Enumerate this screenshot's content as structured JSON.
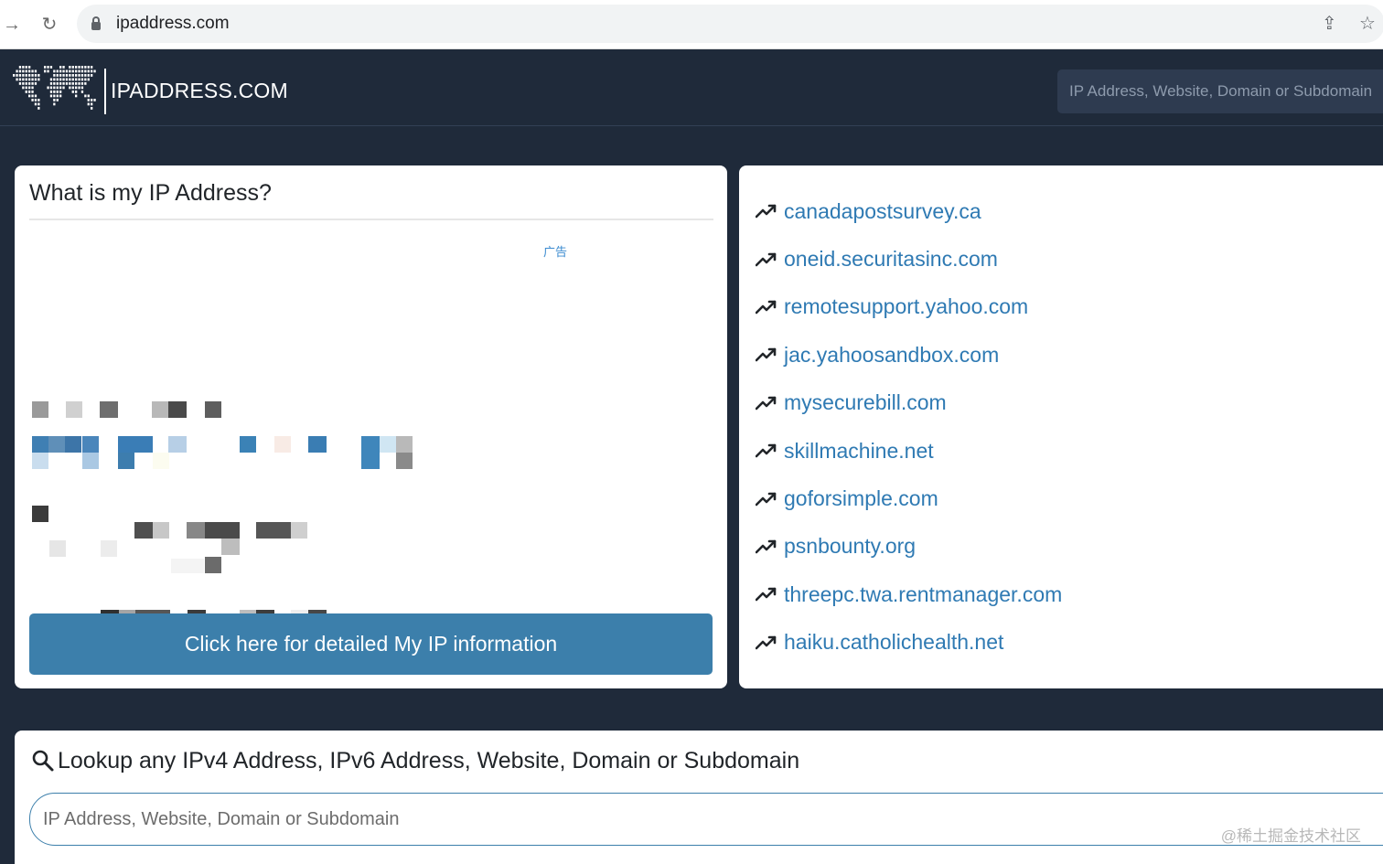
{
  "browser": {
    "url": "ipaddress.com",
    "back_icon": "arrow-right-icon",
    "reload_icon": "reload-icon"
  },
  "header": {
    "logo_text": "IPADDRESS.COM",
    "search_placeholder": "IP Address, Website, Domain or Subdomain"
  },
  "ip_card": {
    "title": "What is my IP Address?",
    "ad_label": "广告",
    "cta_label": "Click here for detailed My IP information"
  },
  "trending": {
    "items": [
      "canadapostsurvey.ca",
      "oneid.securitasinc.com",
      "remotesupport.yahoo.com",
      "jac.yahoosandbox.com",
      "mysecurebill.com",
      "skillmachine.net",
      "goforsimple.com",
      "psnbounty.org",
      "threepc.twa.rentmanager.com",
      "haiku.catholichealth.net"
    ]
  },
  "lookup": {
    "title": "Lookup any IPv4 Address, IPv6 Address, Website, Domain or Subdomain",
    "placeholder": "IP Address, Website, Domain or Subdomain"
  },
  "watermark": "@稀土掘金技术社区",
  "colors": {
    "background": "#1f2a3a",
    "accent": "#3c7fab",
    "link": "#2f7ab3"
  }
}
